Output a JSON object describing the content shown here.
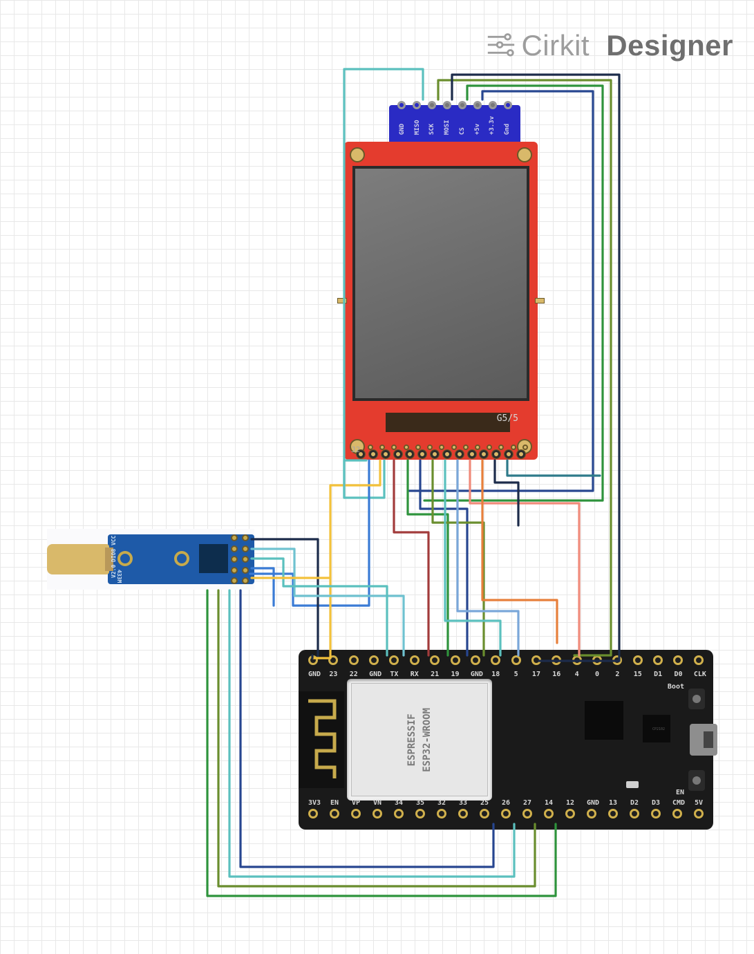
{
  "watermark": {
    "icon": "wires-icon",
    "text_a": "Cirkit",
    "text_b": "Designer"
  },
  "sd_board": {
    "pin_labels": [
      "GND",
      "MISO",
      "SCK",
      "MOSI",
      "CS",
      "+5v",
      "+3.3v",
      "Gnd"
    ],
    "connected_indices": [
      2,
      3,
      4,
      5,
      6
    ]
  },
  "tft_display": {
    "bottom_right_marking": "G5/5",
    "header_j2": "J2",
    "pin_count_bottom": 14
  },
  "rf_module": {
    "side_labels": [
      "DIO8",
      "VCC"
    ],
    "version": "V2.0",
    "freq": "433M",
    "pin_rows": 5
  },
  "esp32": {
    "shield_line1": "ESPRESSIF",
    "shield_line2": "ESP32-WROOM",
    "usb_label": "",
    "cp_chip": "CP2102",
    "btn_boot": "Boot",
    "btn_en": "EN",
    "pins_top": [
      "GND",
      "23",
      "22",
      "GND",
      "TX",
      "RX",
      "21",
      "19",
      "GND",
      "18",
      "5",
      "17",
      "16",
      "4",
      "0",
      "2",
      "15",
      "D1",
      "D0",
      "CLK"
    ],
    "pins_bot": [
      "3V3",
      "EN",
      "VP",
      "VN",
      "34",
      "35",
      "32",
      "33",
      "25",
      "26",
      "27",
      "14",
      "12",
      "GND",
      "13",
      "D2",
      "D3",
      "CMD",
      "5V"
    ]
  },
  "wire_colors": {
    "darknavy": "#1c2b4a",
    "teal": "#5bc0be",
    "navy": "#274690",
    "yellow": "#f3c13a",
    "green": "#2e933c",
    "olive": "#6a8e2e",
    "blue": "#3a7bd5",
    "salmon": "#f08a7a",
    "crimson": "#a23b3b",
    "cyan": "#6fc2d0",
    "orange": "#e77f3b",
    "lightblue": "#7aa7d9"
  }
}
